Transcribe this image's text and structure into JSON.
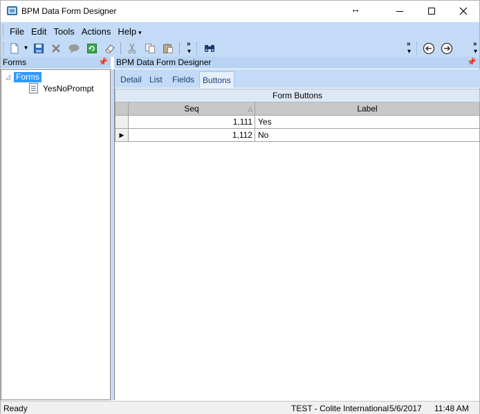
{
  "window": {
    "title": "BPM Data Form Designer",
    "resize_glyph": "↔"
  },
  "menu": {
    "items": [
      "File",
      "Edit",
      "Tools",
      "Actions",
      "Help"
    ]
  },
  "toolbar": {
    "icons": [
      "new-icon",
      "save-icon",
      "delete-icon",
      "comment-icon",
      "refresh-icon",
      "eraser-icon",
      "cut-icon",
      "copy-icon",
      "paste-icon",
      "binoculars-icon",
      "back-icon",
      "forward-icon"
    ],
    "overflow_glyph": "»"
  },
  "left_pane": {
    "header": "Forms",
    "tree": {
      "root_label": "Forms",
      "children": [
        "YesNoPrompt"
      ]
    }
  },
  "right_pane": {
    "header": "BPM Data Form Designer",
    "tabs": [
      "Detail",
      "List",
      "Fields",
      "Buttons"
    ],
    "active_tab": "Buttons",
    "grid": {
      "caption": "Form Buttons",
      "columns": [
        "Seq",
        "Label"
      ],
      "rows": [
        {
          "seq": "1,111",
          "label": "Yes"
        },
        {
          "seq": "1,112",
          "label": "No"
        }
      ]
    }
  },
  "status": {
    "text": "Ready",
    "environment": "TEST - Colite International",
    "date": "5/6/2017",
    "time": "11:48 AM"
  },
  "colors": {
    "band": "#c4dbf7",
    "selection": "#3399ff"
  }
}
